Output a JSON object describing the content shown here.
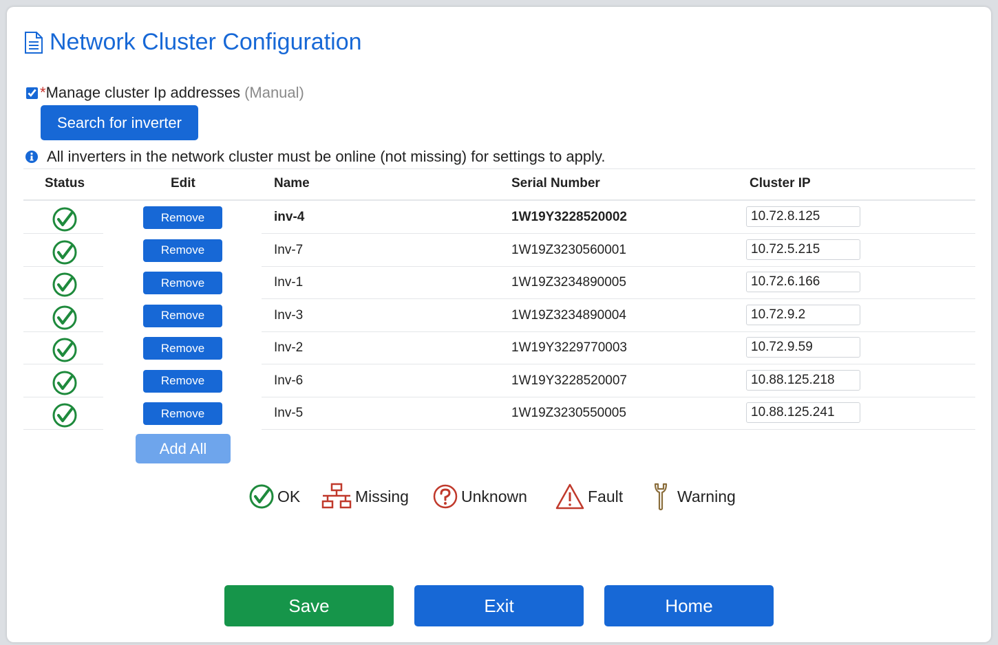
{
  "page": {
    "title": "Network Cluster Configuration",
    "manage_label": "Manage cluster Ip addresses",
    "manage_required_mark": "*",
    "manage_mode": "(Manual)",
    "manage_checked": true,
    "search_button": "Search for inverter",
    "info_text": "All inverters in the network cluster must be online (not missing) for settings to apply."
  },
  "table": {
    "headers": {
      "status": "Status",
      "edit": "Edit",
      "name": "Name",
      "serial": "Serial Number",
      "ip": "Cluster IP"
    },
    "rows": [
      {
        "status": "OK",
        "edit": "Remove",
        "name": "inv-4",
        "serial": "1W19Y3228520002",
        "ip": "10.72.8.125"
      },
      {
        "status": "OK",
        "edit": "Remove",
        "name": "Inv-7",
        "serial": "1W19Z3230560001",
        "ip": "10.72.5.215"
      },
      {
        "status": "OK",
        "edit": "Remove",
        "name": "Inv-1",
        "serial": "1W19Z3234890005",
        "ip": "10.72.6.166"
      },
      {
        "status": "OK",
        "edit": "Remove",
        "name": "Inv-3",
        "serial": "1W19Z3234890004",
        "ip": "10.72.9.2"
      },
      {
        "status": "OK",
        "edit": "Remove",
        "name": "Inv-2",
        "serial": "1W19Y3229770003",
        "ip": "10.72.9.59"
      },
      {
        "status": "OK",
        "edit": "Remove",
        "name": "Inv-6",
        "serial": "1W19Y3228520007",
        "ip": "10.88.125.218"
      },
      {
        "status": "OK",
        "edit": "Remove",
        "name": "Inv-5",
        "serial": "1W19Z3230550005",
        "ip": "10.88.125.241"
      }
    ],
    "add_all": "Add All"
  },
  "legend": {
    "ok": "OK",
    "missing": "Missing",
    "unknown": "Unknown",
    "fault": "Fault",
    "warning": "Warning"
  },
  "buttons": {
    "save": "Save",
    "exit": "Exit",
    "home": "Home"
  },
  "colors": {
    "primary": "#1768d6",
    "save": "#16954a",
    "ok_icon": "#1e8a3c",
    "missing_icon": "#c0392b",
    "unknown_icon": "#c0392b",
    "fault_icon": "#c0392b",
    "warning_icon": "#8a6d3b",
    "required": "#c8312b"
  },
  "icons": {
    "title": "document-icon",
    "info": "info-circle-icon",
    "ok": "check-circle-icon",
    "missing": "network-icon",
    "unknown": "question-circle-icon",
    "fault": "warning-triangle-icon",
    "warning": "wrench-icon"
  }
}
